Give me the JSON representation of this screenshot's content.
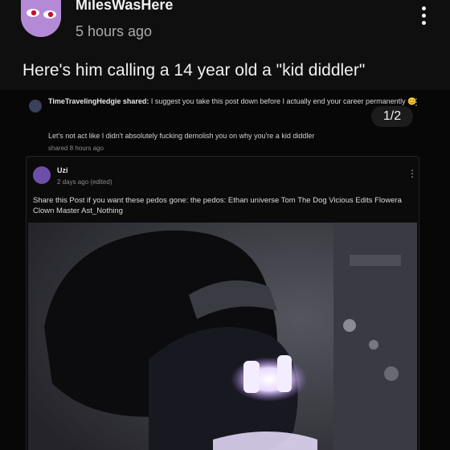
{
  "post": {
    "username": "MilesWasHere",
    "timestamp": "5 hours ago",
    "text": "Here's him calling a 14 year old a \"kid diddler\"",
    "page_indicator": "1/2"
  },
  "screenshot": {
    "comment_author": "TimeTravelingHedgie shared:",
    "comment_text": "I suggest you take this post down before I actually end your career permanently",
    "comment_emoji": "😊",
    "reply_text": "Let's not act like I didn't absolutely fucking demolish you on why you're a kid diddler",
    "reply_meta": "shared 8 hours ago",
    "shared_post": {
      "author": "Uzi",
      "time": "2 days ago (edited)",
      "text": "Share this Post if you want these pedos gone: the pedos: Ethan universe Tom The Dog Vicious Edits Flowera Clown Master Ast_Nothing"
    }
  },
  "colors": {
    "background": "#0f0f0f",
    "avatar": "#b48ad6",
    "secondary_text": "#aaaaaa",
    "glow": "#efe3ff"
  },
  "icons": {
    "more": "three-dots-vertical",
    "avatar_art": "purple-face-red-eyes"
  }
}
